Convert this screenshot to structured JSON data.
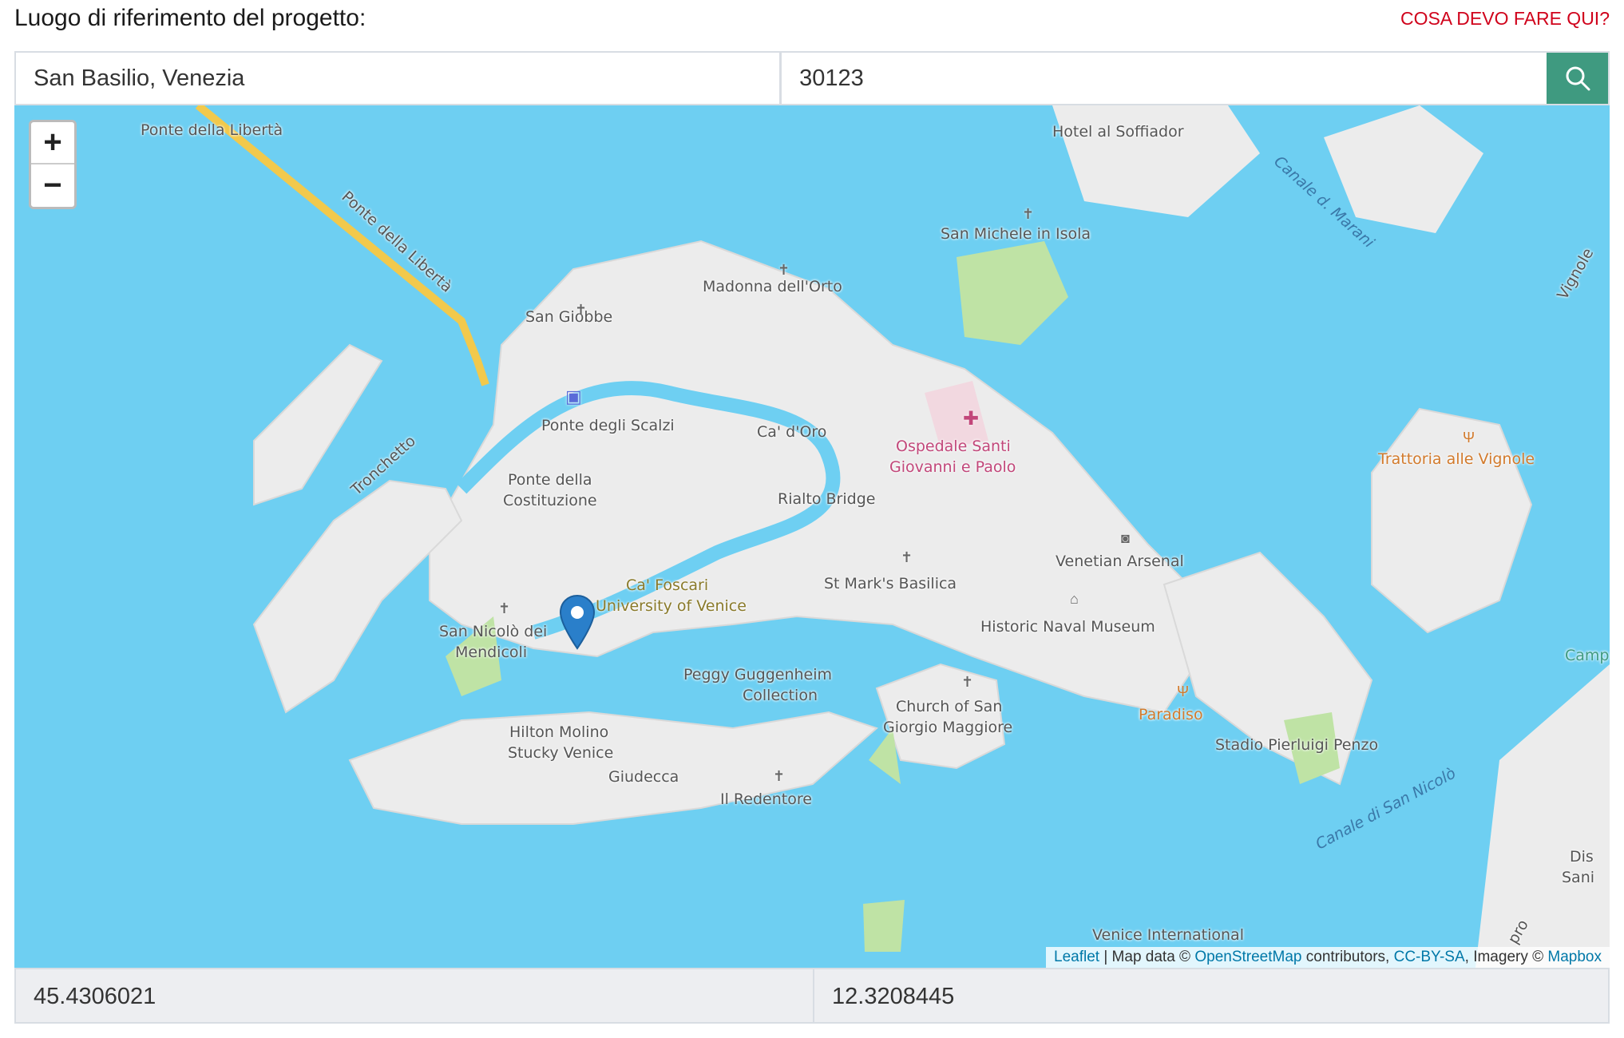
{
  "header": {
    "title": "Luogo di riferimento del progetto:",
    "help_link": "COSA DEVO FARE QUI?"
  },
  "search": {
    "address_value": "San Basilio, Venezia",
    "zip_value": "30123",
    "button_icon": "search-icon"
  },
  "map": {
    "zoom_in": "+",
    "zoom_out": "−",
    "labels": {
      "ponte_liberta_1": "Ponte della Libertà",
      "ponte_liberta_2": "Ponte della Libertà",
      "hotel_soffiador": "Hotel al Soffiador",
      "canale_marani": "Canale d. Marani",
      "san_michele": "San Michele in Isola",
      "madonna_orto": "Madonna dell'Orto",
      "san_giobbe": "San Giobbe",
      "vignole": "Vignole",
      "ponte_scalzi": "Ponte degli Scalzi",
      "ca_doro": "Ca' d'Oro",
      "ospedale_1": "Ospedale Santi",
      "ospedale_2": "Giovanni e Paolo",
      "trattoria": "Trattoria alle Vignole",
      "tronchetto": "Tronchetto",
      "ponte_costituzione_1": "Ponte della",
      "ponte_costituzione_2": "Costituzione",
      "rialto": "Rialto Bridge",
      "venetian_arsenal": "Venetian Arsenal",
      "ca_foscari_1": "Ca' Foscari",
      "ca_foscari_2": "University of Venice",
      "st_marks": "St Mark's Basilica",
      "historic_naval": "Historic Naval Museum",
      "san_nicolo_1": "San Nicolò dei",
      "san_nicolo_2": "Mendicoli",
      "peggy_1": "Peggy Guggenheim",
      "peggy_2": "Collection",
      "camp": "Camp",
      "paradiso": "Paradiso",
      "church_san_giorgio_1": "Church of San",
      "church_san_giorgio_2": "Giorgio Maggiore",
      "hilton_1": "Hilton Molino",
      "hilton_2": "Stucky Venice",
      "stadio": "Stadio Pierluigi Penzo",
      "giudecca": "Giudecca",
      "redentore": "Il Redentore",
      "canale_san_nicolo": "Canale di San Nicolò",
      "dis_1": "Dis",
      "dis_2": "Sani",
      "venice_international": "Venice International",
      "pro": "pro"
    },
    "attribution": {
      "leaflet": "Leaflet",
      "sep1": " | Map data © ",
      "osm": "OpenStreetMap",
      "contributors": " contributors, ",
      "ccbysa": "CC-BY-SA",
      "imagery": ", Imagery © ",
      "mapbox": "Mapbox"
    },
    "colors": {
      "water": "#6ecff2",
      "land": "#ececec",
      "park": "#bfe3a5",
      "bridge": "#f2c94c",
      "marker": "#2a7fca"
    }
  },
  "coordinates": {
    "lat": "45.4306021",
    "lng": "12.3208445"
  }
}
